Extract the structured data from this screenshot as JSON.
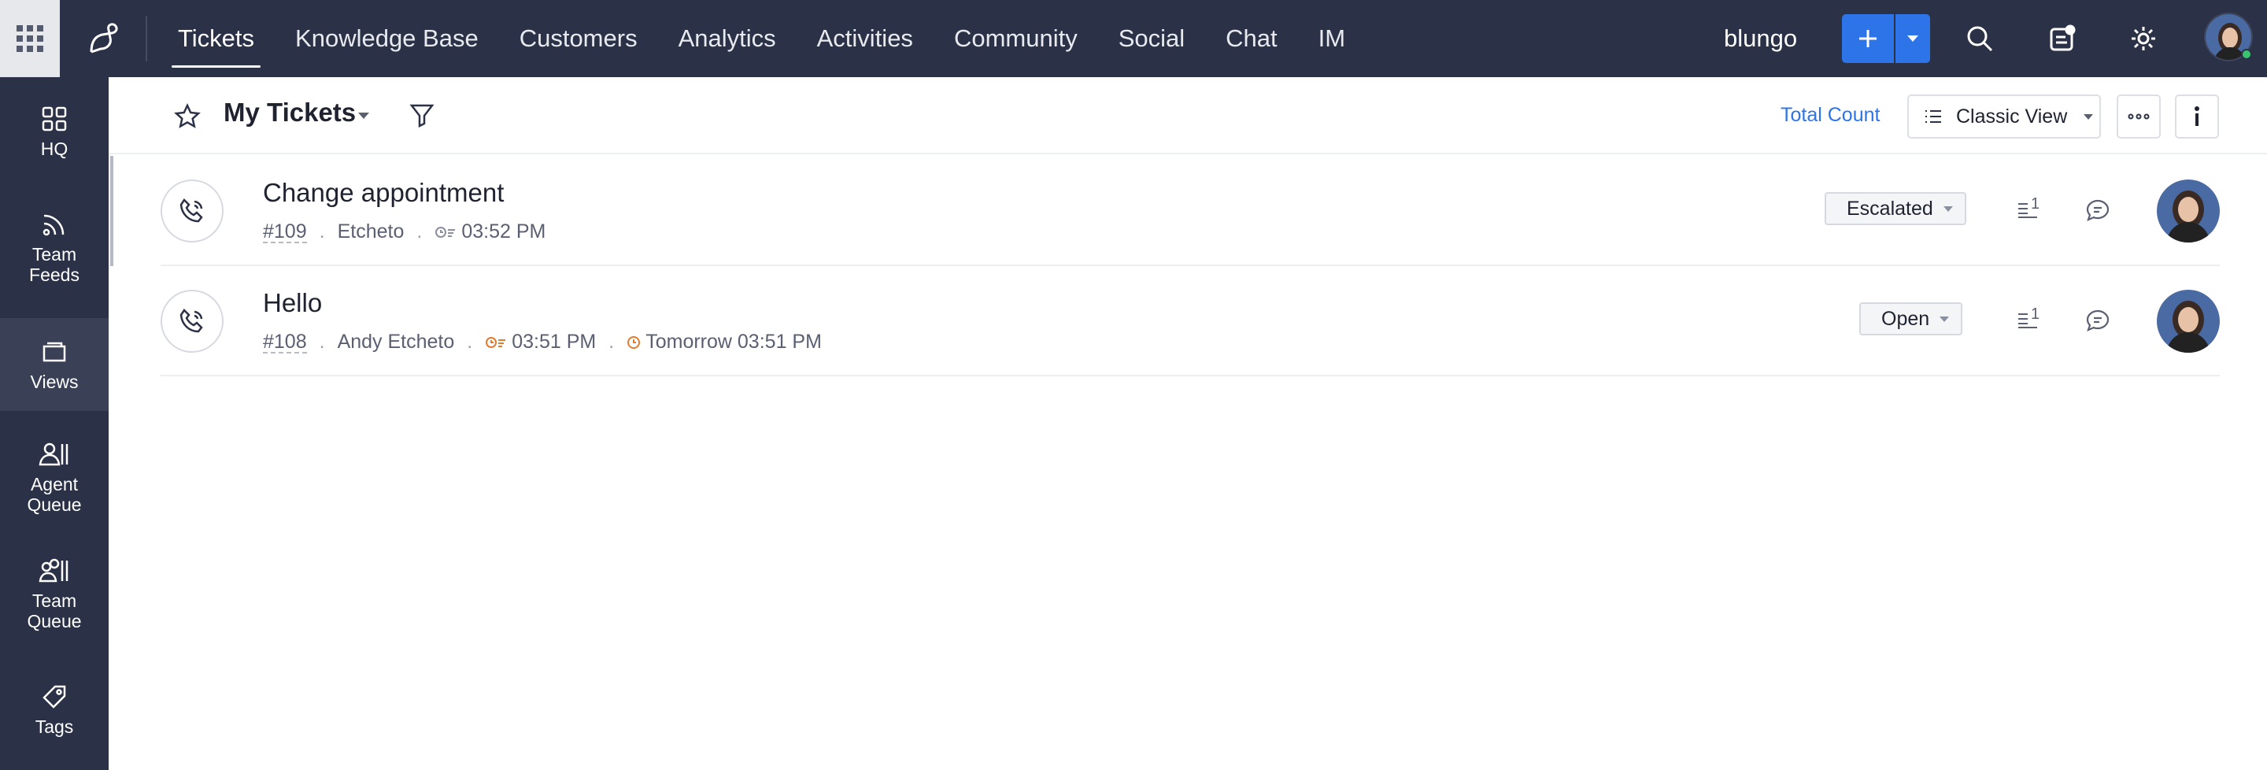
{
  "topnav": {
    "tabs": [
      {
        "label": "Tickets",
        "active": true
      },
      {
        "label": "Knowledge Base",
        "active": false
      },
      {
        "label": "Customers",
        "active": false
      },
      {
        "label": "Analytics",
        "active": false
      },
      {
        "label": "Activities",
        "active": false
      },
      {
        "label": "Community",
        "active": false
      },
      {
        "label": "Social",
        "active": false
      },
      {
        "label": "Chat",
        "active": false
      },
      {
        "label": "IM",
        "active": false
      }
    ],
    "org_name": "blungo",
    "accent_color": "#2c74e8",
    "bar_color": "#2b3146"
  },
  "sidebar": {
    "items": [
      {
        "label": "HQ",
        "icon": "grid-icon",
        "active": false
      },
      {
        "label": "Team Feeds",
        "icon": "feed-icon",
        "active": false
      },
      {
        "label": "Views",
        "icon": "folder-icon",
        "active": true
      },
      {
        "label": "Agent Queue",
        "icon": "agent-icon",
        "active": false
      },
      {
        "label": "Team Queue",
        "icon": "team-icon",
        "active": false
      },
      {
        "label": "Tags",
        "icon": "tag-icon",
        "active": false
      }
    ]
  },
  "header": {
    "view_title": "My Tickets",
    "total_count_label": "Total Count",
    "view_mode_label": "Classic View"
  },
  "tickets": [
    {
      "subject": "Change appointment",
      "id": "#109",
      "contact": "Etcheto",
      "response_time": "03:52 PM",
      "due_time": "",
      "status": "Escalated",
      "channel": "phone-icon",
      "thread_count": "1"
    },
    {
      "subject": "Hello",
      "id": "#108",
      "contact": "Andy Etcheto",
      "response_time": "03:51 PM",
      "due_time": "Tomorrow 03:51 PM",
      "status": "Open",
      "channel": "phone-icon",
      "thread_count": "1"
    }
  ]
}
